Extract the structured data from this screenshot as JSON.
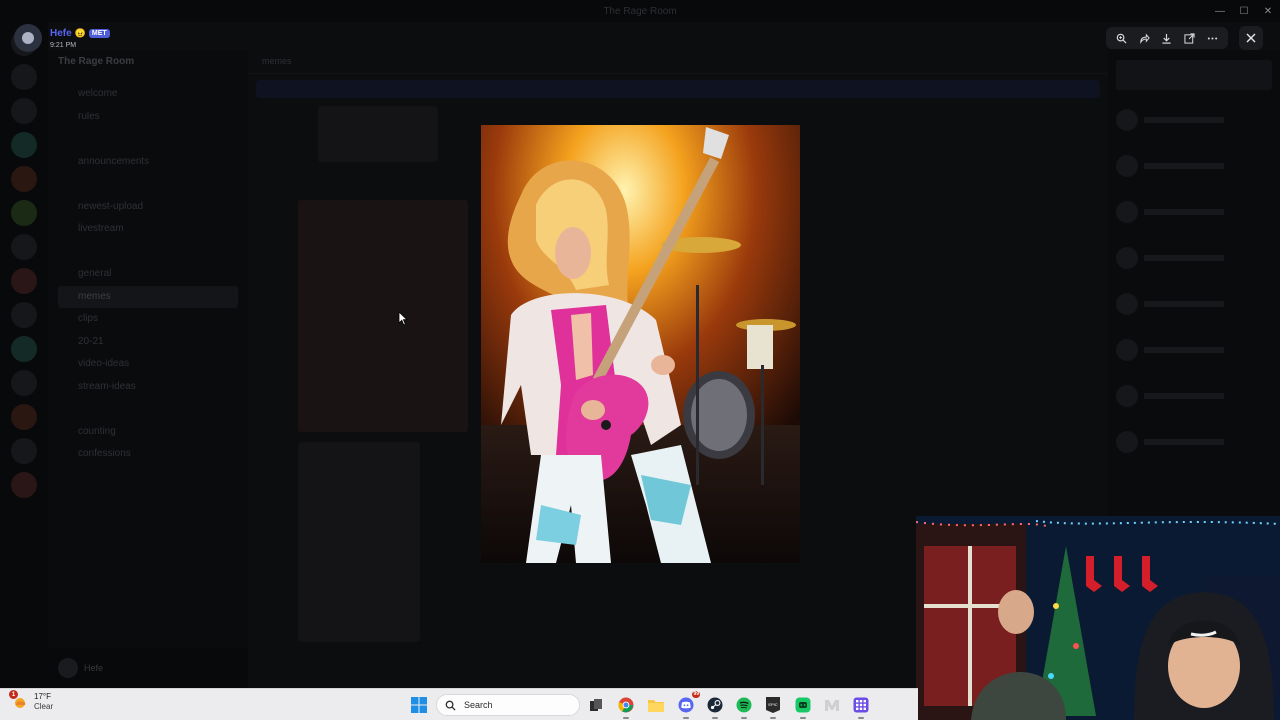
{
  "lightbox": {
    "user_name": "Hefe",
    "user_emoji": "😠",
    "user_badge": "MET",
    "timestamp": "9:21 PM",
    "toolbar": [
      {
        "icon": "zoom-in-icon",
        "label": "Zoom"
      },
      {
        "icon": "forward-icon",
        "label": "Forward"
      },
      {
        "icon": "download-icon",
        "label": "Download"
      },
      {
        "icon": "open-in-browser-icon",
        "label": "Open in Browser"
      },
      {
        "icon": "more-icon",
        "label": "More"
      }
    ],
    "close_icon": "close-icon",
    "image_subject": "guitarist-photo"
  },
  "background": {
    "window_title": "The Rage Room",
    "server_name": "The Rage Room",
    "channel_header": "memes",
    "channels": [
      "welcome",
      "rules",
      "",
      "announcements",
      "",
      "newest-upload",
      "livestream",
      "",
      "general",
      "memes",
      "clips",
      "20-21",
      "video-ideas",
      "stream-ideas",
      "",
      "counting",
      "confessions"
    ],
    "active_channel": "memes",
    "user_panel_name": "Hefe"
  },
  "taskbar": {
    "weather_temp": "17°F",
    "weather_condition": "Clear",
    "weather_badge": "1",
    "search_placeholder": "Search",
    "apps": [
      {
        "name": "start-button",
        "icon": "windows-logo-icon"
      },
      {
        "name": "taskview-button",
        "icon": "taskview-icon"
      },
      {
        "name": "chrome-button",
        "icon": "chrome-icon"
      },
      {
        "name": "file-explorer-button",
        "icon": "folder-icon"
      },
      {
        "name": "discord-button",
        "icon": "discord-icon",
        "badge": "99"
      },
      {
        "name": "steam-button",
        "icon": "steam-icon"
      },
      {
        "name": "spotify-button",
        "icon": "spotify-icon"
      },
      {
        "name": "epic-games-button",
        "icon": "epic-games-icon"
      },
      {
        "name": "app-green-button",
        "icon": "app-icon"
      },
      {
        "name": "app-m-button",
        "icon": "m-icon"
      },
      {
        "name": "app-grid-button",
        "icon": "grid-icon"
      }
    ]
  },
  "colors": {
    "accent": "#5865f2",
    "overlay": "#000000",
    "taskbar": "#ececef"
  }
}
